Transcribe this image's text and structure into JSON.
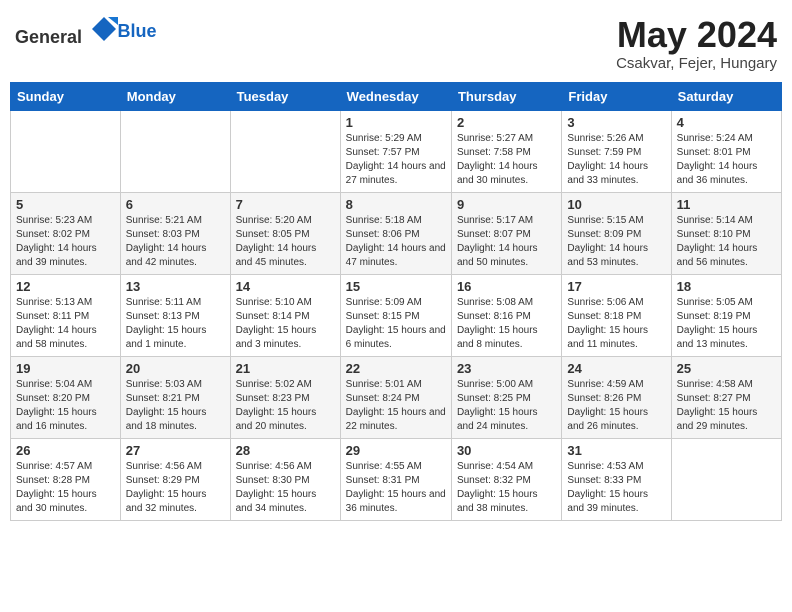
{
  "header": {
    "logo_general": "General",
    "logo_blue": "Blue",
    "month_year": "May 2024",
    "location": "Csakvar, Fejer, Hungary"
  },
  "days_of_week": [
    "Sunday",
    "Monday",
    "Tuesday",
    "Wednesday",
    "Thursday",
    "Friday",
    "Saturday"
  ],
  "weeks": [
    [
      {
        "day": "",
        "content": ""
      },
      {
        "day": "",
        "content": ""
      },
      {
        "day": "",
        "content": ""
      },
      {
        "day": "1",
        "content": "Sunrise: 5:29 AM\nSunset: 7:57 PM\nDaylight: 14 hours and 27 minutes."
      },
      {
        "day": "2",
        "content": "Sunrise: 5:27 AM\nSunset: 7:58 PM\nDaylight: 14 hours and 30 minutes."
      },
      {
        "day": "3",
        "content": "Sunrise: 5:26 AM\nSunset: 7:59 PM\nDaylight: 14 hours and 33 minutes."
      },
      {
        "day": "4",
        "content": "Sunrise: 5:24 AM\nSunset: 8:01 PM\nDaylight: 14 hours and 36 minutes."
      }
    ],
    [
      {
        "day": "5",
        "content": "Sunrise: 5:23 AM\nSunset: 8:02 PM\nDaylight: 14 hours and 39 minutes."
      },
      {
        "day": "6",
        "content": "Sunrise: 5:21 AM\nSunset: 8:03 PM\nDaylight: 14 hours and 42 minutes."
      },
      {
        "day": "7",
        "content": "Sunrise: 5:20 AM\nSunset: 8:05 PM\nDaylight: 14 hours and 45 minutes."
      },
      {
        "day": "8",
        "content": "Sunrise: 5:18 AM\nSunset: 8:06 PM\nDaylight: 14 hours and 47 minutes."
      },
      {
        "day": "9",
        "content": "Sunrise: 5:17 AM\nSunset: 8:07 PM\nDaylight: 14 hours and 50 minutes."
      },
      {
        "day": "10",
        "content": "Sunrise: 5:15 AM\nSunset: 8:09 PM\nDaylight: 14 hours and 53 minutes."
      },
      {
        "day": "11",
        "content": "Sunrise: 5:14 AM\nSunset: 8:10 PM\nDaylight: 14 hours and 56 minutes."
      }
    ],
    [
      {
        "day": "12",
        "content": "Sunrise: 5:13 AM\nSunset: 8:11 PM\nDaylight: 14 hours and 58 minutes."
      },
      {
        "day": "13",
        "content": "Sunrise: 5:11 AM\nSunset: 8:13 PM\nDaylight: 15 hours and 1 minute."
      },
      {
        "day": "14",
        "content": "Sunrise: 5:10 AM\nSunset: 8:14 PM\nDaylight: 15 hours and 3 minutes."
      },
      {
        "day": "15",
        "content": "Sunrise: 5:09 AM\nSunset: 8:15 PM\nDaylight: 15 hours and 6 minutes."
      },
      {
        "day": "16",
        "content": "Sunrise: 5:08 AM\nSunset: 8:16 PM\nDaylight: 15 hours and 8 minutes."
      },
      {
        "day": "17",
        "content": "Sunrise: 5:06 AM\nSunset: 8:18 PM\nDaylight: 15 hours and 11 minutes."
      },
      {
        "day": "18",
        "content": "Sunrise: 5:05 AM\nSunset: 8:19 PM\nDaylight: 15 hours and 13 minutes."
      }
    ],
    [
      {
        "day": "19",
        "content": "Sunrise: 5:04 AM\nSunset: 8:20 PM\nDaylight: 15 hours and 16 minutes."
      },
      {
        "day": "20",
        "content": "Sunrise: 5:03 AM\nSunset: 8:21 PM\nDaylight: 15 hours and 18 minutes."
      },
      {
        "day": "21",
        "content": "Sunrise: 5:02 AM\nSunset: 8:23 PM\nDaylight: 15 hours and 20 minutes."
      },
      {
        "day": "22",
        "content": "Sunrise: 5:01 AM\nSunset: 8:24 PM\nDaylight: 15 hours and 22 minutes."
      },
      {
        "day": "23",
        "content": "Sunrise: 5:00 AM\nSunset: 8:25 PM\nDaylight: 15 hours and 24 minutes."
      },
      {
        "day": "24",
        "content": "Sunrise: 4:59 AM\nSunset: 8:26 PM\nDaylight: 15 hours and 26 minutes."
      },
      {
        "day": "25",
        "content": "Sunrise: 4:58 AM\nSunset: 8:27 PM\nDaylight: 15 hours and 29 minutes."
      }
    ],
    [
      {
        "day": "26",
        "content": "Sunrise: 4:57 AM\nSunset: 8:28 PM\nDaylight: 15 hours and 30 minutes."
      },
      {
        "day": "27",
        "content": "Sunrise: 4:56 AM\nSunset: 8:29 PM\nDaylight: 15 hours and 32 minutes."
      },
      {
        "day": "28",
        "content": "Sunrise: 4:56 AM\nSunset: 8:30 PM\nDaylight: 15 hours and 34 minutes."
      },
      {
        "day": "29",
        "content": "Sunrise: 4:55 AM\nSunset: 8:31 PM\nDaylight: 15 hours and 36 minutes."
      },
      {
        "day": "30",
        "content": "Sunrise: 4:54 AM\nSunset: 8:32 PM\nDaylight: 15 hours and 38 minutes."
      },
      {
        "day": "31",
        "content": "Sunrise: 4:53 AM\nSunset: 8:33 PM\nDaylight: 15 hours and 39 minutes."
      },
      {
        "day": "",
        "content": ""
      }
    ]
  ]
}
